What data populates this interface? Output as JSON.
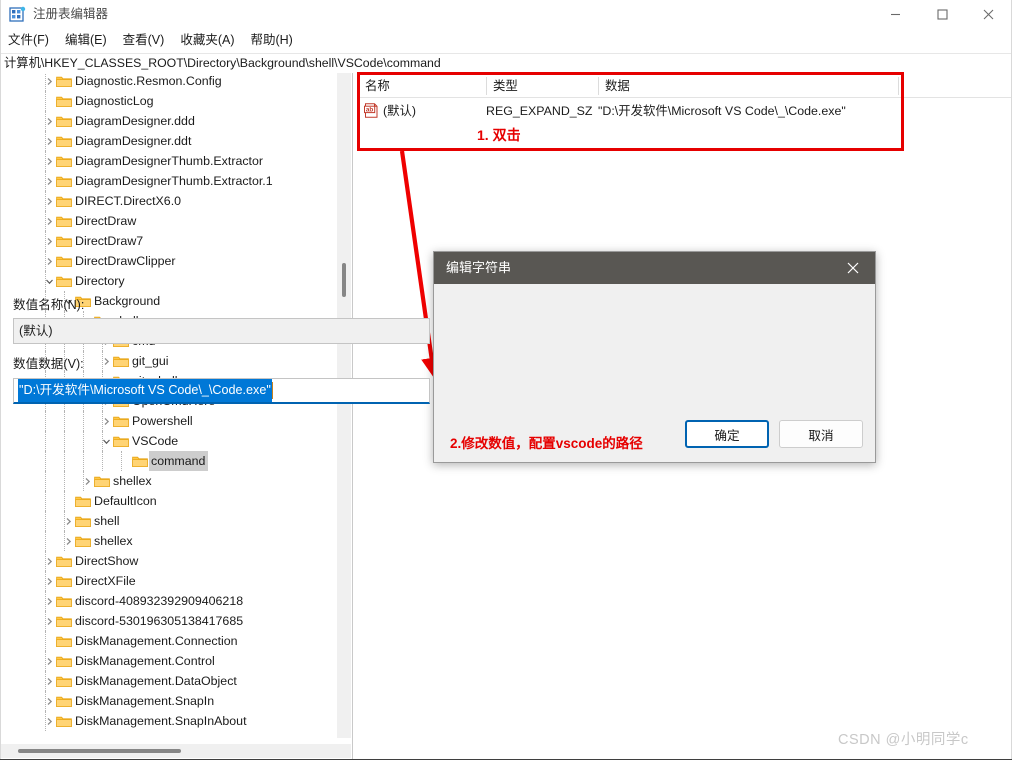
{
  "window": {
    "title": "注册表编辑器",
    "icon": "registry-editor-icon",
    "controls": {
      "minimize": "minimize-icon",
      "maximize": "maximize-icon",
      "close": "close-icon"
    }
  },
  "menubar": {
    "items": [
      {
        "label": "文件(F)"
      },
      {
        "label": "编辑(E)"
      },
      {
        "label": "查看(V)"
      },
      {
        "label": "收藏夹(A)"
      },
      {
        "label": "帮助(H)"
      }
    ]
  },
  "address": {
    "path": "计算机\\HKEY_CLASSES_ROOT\\Directory\\Background\\shell\\VSCode\\command"
  },
  "tree": {
    "items": [
      {
        "label": "Diagnostic.Resmon.Config",
        "depth": 0,
        "expander": "collapsed",
        "selected": false
      },
      {
        "label": "DiagnosticLog",
        "depth": 0,
        "expander": "none",
        "selected": false
      },
      {
        "label": "DiagramDesigner.ddd",
        "depth": 0,
        "expander": "collapsed",
        "selected": false
      },
      {
        "label": "DiagramDesigner.ddt",
        "depth": 0,
        "expander": "collapsed",
        "selected": false
      },
      {
        "label": "DiagramDesignerThumb.Extractor",
        "depth": 0,
        "expander": "collapsed",
        "selected": false
      },
      {
        "label": "DiagramDesignerThumb.Extractor.1",
        "depth": 0,
        "expander": "collapsed",
        "selected": false
      },
      {
        "label": "DIRECT.DirectX6.0",
        "depth": 0,
        "expander": "collapsed",
        "selected": false
      },
      {
        "label": "DirectDraw",
        "depth": 0,
        "expander": "collapsed",
        "selected": false
      },
      {
        "label": "DirectDraw7",
        "depth": 0,
        "expander": "collapsed",
        "selected": false
      },
      {
        "label": "DirectDrawClipper",
        "depth": 0,
        "expander": "collapsed",
        "selected": false
      },
      {
        "label": "Directory",
        "depth": 0,
        "expander": "expanded",
        "selected": false
      },
      {
        "label": "Background",
        "depth": 1,
        "expander": "expanded",
        "selected": false
      },
      {
        "label": "shell",
        "depth": 2,
        "expander": "expanded",
        "selected": false
      },
      {
        "label": "cmd",
        "depth": 3,
        "expander": "collapsed",
        "selected": false
      },
      {
        "label": "git_gui",
        "depth": 3,
        "expander": "collapsed",
        "selected": false
      },
      {
        "label": "git_shell",
        "depth": 3,
        "expander": "collapsed",
        "selected": false
      },
      {
        "label": "OpenCmdHere",
        "depth": 3,
        "expander": "collapsed",
        "selected": false
      },
      {
        "label": "Powershell",
        "depth": 3,
        "expander": "collapsed",
        "selected": false
      },
      {
        "label": "VSCode",
        "depth": 3,
        "expander": "expanded",
        "selected": false
      },
      {
        "label": "command",
        "depth": 4,
        "expander": "none",
        "selected": true
      },
      {
        "label": "shellex",
        "depth": 2,
        "expander": "collapsed",
        "selected": false
      },
      {
        "label": "DefaultIcon",
        "depth": 1,
        "expander": "none",
        "selected": false
      },
      {
        "label": "shell",
        "depth": 1,
        "expander": "collapsed",
        "selected": false
      },
      {
        "label": "shellex",
        "depth": 1,
        "expander": "collapsed",
        "selected": false
      },
      {
        "label": "DirectShow",
        "depth": 0,
        "expander": "collapsed",
        "selected": false
      },
      {
        "label": "DirectXFile",
        "depth": 0,
        "expander": "collapsed",
        "selected": false
      },
      {
        "label": "discord-408932392909406218",
        "depth": 0,
        "expander": "collapsed",
        "selected": false
      },
      {
        "label": "discord-530196305138417685",
        "depth": 0,
        "expander": "collapsed",
        "selected": false
      },
      {
        "label": "DiskManagement.Connection",
        "depth": 0,
        "expander": "none",
        "selected": false
      },
      {
        "label": "DiskManagement.Control",
        "depth": 0,
        "expander": "collapsed",
        "selected": false
      },
      {
        "label": "DiskManagement.DataObject",
        "depth": 0,
        "expander": "collapsed",
        "selected": false
      },
      {
        "label": "DiskManagement.SnapIn",
        "depth": 0,
        "expander": "collapsed",
        "selected": false
      },
      {
        "label": "DiskManagement.SnapInAbout",
        "depth": 0,
        "expander": "collapsed",
        "selected": false
      }
    ]
  },
  "values": {
    "columns": [
      {
        "label": "名称"
      },
      {
        "label": "类型"
      },
      {
        "label": "数据"
      }
    ],
    "rows": [
      {
        "icon": "string-value-icon",
        "name": "(默认)",
        "type": "REG_EXPAND_SZ",
        "data": "\"D:\\开发软件\\Microsoft VS Code\\_\\Code.exe\""
      }
    ]
  },
  "dialog": {
    "title": "编辑字符串",
    "close_icon": "close-icon",
    "name_label": "数值名称(N):",
    "name_value": "(默认)",
    "data_label": "数值数据(V):",
    "data_value": "\"D:\\开发软件\\Microsoft VS Code\\_\\Code.exe\"",
    "ok_label": "确定",
    "cancel_label": "取消"
  },
  "annotations": {
    "step1": "1. 双击",
    "step2": "2.修改数值，配置vscode的路径",
    "arrow": "red-arrow-annotation",
    "box_color": "#e60000"
  },
  "watermark": {
    "text": "CSDN @小明同学c"
  }
}
